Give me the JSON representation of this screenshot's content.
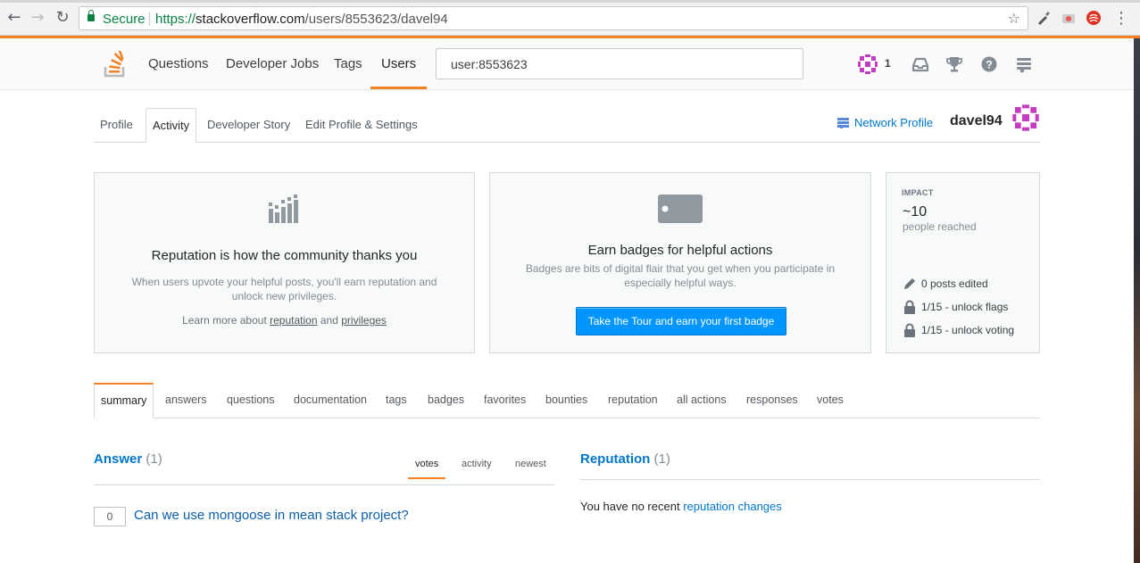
{
  "browser": {
    "secure_label": "Secure",
    "url_scheme": "https://",
    "url_host": "stackoverflow.com",
    "url_path": "/users/8553623/davel94"
  },
  "header": {
    "nav": [
      "Questions",
      "Developer Jobs",
      "Tags",
      "Users"
    ],
    "search_value": "user:8553623",
    "reputation": "1"
  },
  "profile_tabs": [
    "Profile",
    "Activity",
    "Developer Story",
    "Edit Profile & Settings"
  ],
  "network_profile_label": "Network Profile",
  "username": "davel94",
  "reputation_card": {
    "title": "Reputation is how the community thanks you",
    "text": "When users upvote your helpful posts, you'll earn reputation and unlock new privileges.",
    "learn_prefix": "Learn more about",
    "learn_link1": "reputation",
    "learn_and": "and",
    "learn_link2": "privileges"
  },
  "badges_card": {
    "title": "Earn badges for helpful actions",
    "text": "Badges are bits of digital flair that you get when you participate in especially helpful ways.",
    "button": "Take the Tour and earn your first badge"
  },
  "impact": {
    "label": "IMPACT",
    "value": "~10",
    "sub": "people reached",
    "stats": [
      "0 posts edited",
      "1/15 - unlock flags",
      "1/15 - unlock voting"
    ]
  },
  "activity_tabs": [
    "summary",
    "answers",
    "questions",
    "documentation",
    "tags",
    "badges",
    "favorites",
    "bounties",
    "reputation",
    "all actions",
    "responses",
    "votes"
  ],
  "answers": {
    "title": "Answer",
    "count": "(1)",
    "sorts": [
      "votes",
      "activity",
      "newest"
    ],
    "items": [
      {
        "votes": "0",
        "title": "Can we use mongoose in mean stack project?"
      }
    ]
  },
  "reputation_section": {
    "title": "Reputation",
    "count": "(1)",
    "text_prefix": "You have no recent",
    "link": "reputation changes"
  },
  "colors": {
    "accent": "#f48024",
    "link": "#0077cc",
    "button": "#0095ff"
  }
}
